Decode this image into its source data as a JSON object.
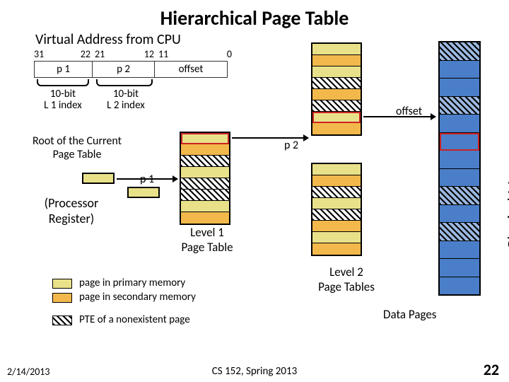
{
  "title": "Hierarchical Page Table",
  "va": {
    "caption": "Virtual Address from CPU",
    "bit_31": "31",
    "bit_22": "22",
    "bit_21": "21",
    "bit_12": "12",
    "bit_11": "11",
    "bit_0": "0",
    "p1": "p 1",
    "p2": "p 2",
    "offset": "offset"
  },
  "l1_index": {
    "line1": "10-bit",
    "line2": "L 1 index"
  },
  "l2_index": {
    "line1": "10-bit",
    "line2": "L 2 index"
  },
  "root_label": {
    "line1": "Root of the Current",
    "line2": "Page Table"
  },
  "proc_reg": {
    "line1": "(Processor",
    "line2": "Register)"
  },
  "p1_arrow_label": "p 1",
  "p2_arrow_label": "p 2",
  "offset_arrow_label": "offset",
  "level1_label": {
    "line1": "Level 1",
    "line2": "Page Table"
  },
  "level2_label": {
    "line1": "Level 2",
    "line2": "Page Tables"
  },
  "data_pages_label": "Data Pages",
  "phys_mem_label": "Physical Memory",
  "legend": {
    "primary": "page in primary memory",
    "secondary": "page in secondary memory",
    "pte_ne": "PTE of a nonexistent page"
  },
  "footer": {
    "date": "2/14/2013",
    "center": "CS 152, Spring 2013",
    "page": "22"
  }
}
